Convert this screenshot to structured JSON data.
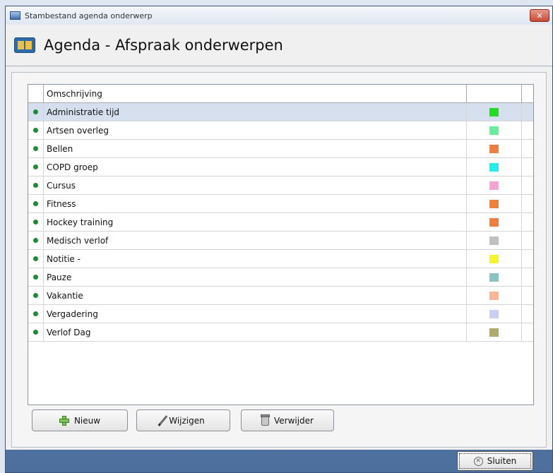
{
  "window": {
    "title": "Stambestand agenda onderwerp",
    "close_glyph": "✕"
  },
  "header": {
    "title": "Agenda - Afspraak onderwerpen",
    "icon": "agenda-book-icon"
  },
  "table": {
    "columns": [
      "Omschrijving",
      ""
    ],
    "rows": [
      {
        "label": "Administratie tijd",
        "color": "#22dd22",
        "selected": true
      },
      {
        "label": "Artsen overleg",
        "color": "#66ee99"
      },
      {
        "label": "Bellen",
        "color": "#f07f3c"
      },
      {
        "label": "COPD groep",
        "color": "#22eeee"
      },
      {
        "label": "Cursus",
        "color": "#f7a3d6"
      },
      {
        "label": "Fitness",
        "color": "#f07f3c"
      },
      {
        "label": "Hockey training",
        "color": "#f07f3c"
      },
      {
        "label": "Medisch verlof",
        "color": "#c0c0c0"
      },
      {
        "label": "Notitie -",
        "color": "#f5f52a"
      },
      {
        "label": "Pauze",
        "color": "#88c4c4"
      },
      {
        "label": "Vakantie",
        "color": "#f8b896"
      },
      {
        "label": "Vergadering",
        "color": "#c8d0f4"
      },
      {
        "label": "Verlof Dag",
        "color": "#b0aa6a"
      }
    ]
  },
  "toolbar": {
    "new_label": "Nieuw",
    "edit_label": "Wijzigen",
    "delete_label": "Verwijder"
  },
  "footer": {
    "close_label": "Sluiten"
  },
  "colors": {
    "row_indicator": "#1f8a35",
    "selected_row": "#d5dfee"
  }
}
